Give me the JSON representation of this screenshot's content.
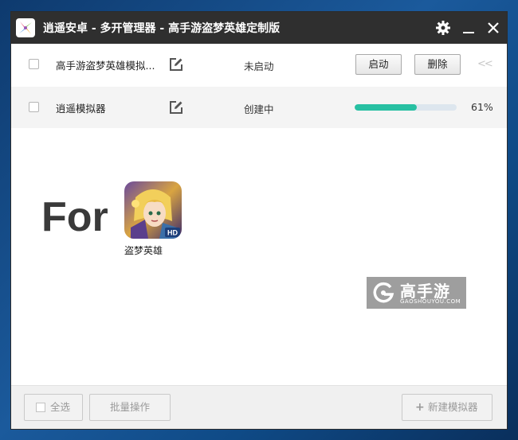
{
  "window": {
    "title": "逍遥安卓 - 多开管理器 - 高手游盗梦英雄定制版",
    "controls": [
      "settings-gear",
      "minimize",
      "close"
    ]
  },
  "emulators": [
    {
      "name": "高手游盗梦英雄模拟...",
      "status": "未启动",
      "start_label": "启动",
      "delete_label": "删除",
      "collapse_label": "<<"
    },
    {
      "name": "逍遥模拟器",
      "status": "创建中",
      "progress": 0.61,
      "progress_label": "61%"
    }
  ],
  "promo": {
    "for_text": "For",
    "game_name": "盗梦英雄",
    "badge": "HD"
  },
  "watermark": {
    "cn": "高手游",
    "en": "GAOSHOUYOU.COM"
  },
  "footer": {
    "select_all_label": "全选",
    "batch_label": "批量操作",
    "new_plus": "+",
    "new_label": "新建模拟器"
  },
  "colors": {
    "titlebar": "#2f2f2f",
    "progress": "#27c0a2",
    "progress_track": "#dde6ee",
    "row_alt": "#f4f4f4",
    "footer": "#f0f0f0"
  }
}
